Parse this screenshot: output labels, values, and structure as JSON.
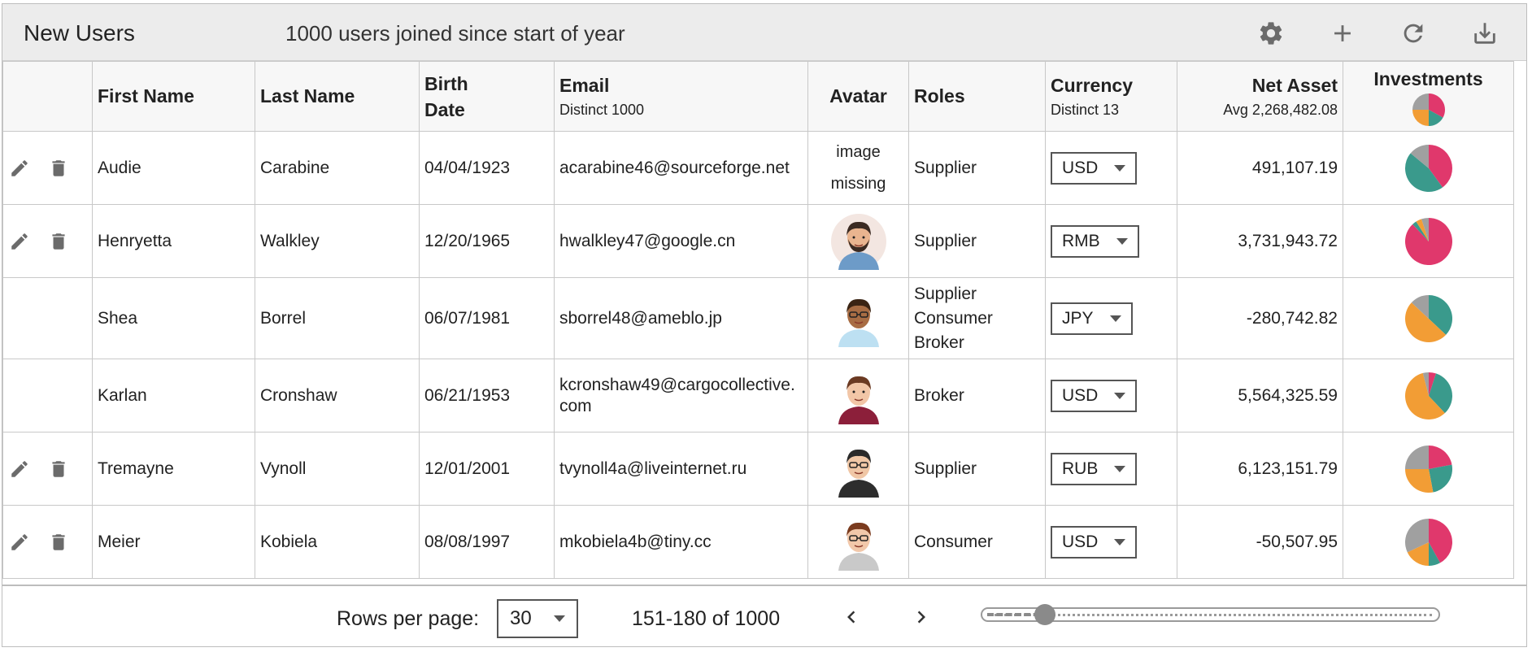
{
  "toolbar": {
    "title": "New Users",
    "subtitle": "1000 users joined since start of year",
    "icons": [
      "gear-icon",
      "plus-icon",
      "refresh-icon",
      "download-icon"
    ]
  },
  "columns": {
    "first_name": "First Name",
    "last_name": "Last Name",
    "birth_date_line1": "Birth",
    "birth_date_line2": "Date",
    "email": "Email",
    "email_sub": "Distinct 1000",
    "avatar": "Avatar",
    "roles": "Roles",
    "currency": "Currency",
    "currency_sub": "Distinct 13",
    "net_asset": "Net Asset",
    "net_asset_sub": "Avg 2,268,482.08",
    "investments": "Investments"
  },
  "header_pie": [
    0.33,
    0.17,
    0.25,
    0.25
  ],
  "colors": {
    "pie": [
      "#e0386c",
      "#3a9a8c",
      "#f29d35",
      "#a0a0a0"
    ],
    "icon": "#6b6b6b",
    "toolbar_bg": "#ececec"
  },
  "avatar_missing_text": [
    "image",
    "missing"
  ],
  "rows": [
    {
      "actions": true,
      "first": "Audie",
      "last": "Carabine",
      "birth": "04/04/1923",
      "email": [
        "acarabine46@sourceforge.net"
      ],
      "avatar": "missing",
      "roles": [
        "Supplier"
      ],
      "currency": "USD",
      "net": "491,107.19",
      "pie": [
        0.4,
        0.46,
        0.0,
        0.14
      ]
    },
    {
      "actions": true,
      "first": "Henryetta",
      "last": "Walkley",
      "birth": "12/20/1965",
      "email": [
        "hwalkley47@google.cn"
      ],
      "avatar": "man-beard",
      "roles": [
        "Supplier"
      ],
      "currency": "RMB",
      "net": "3,731,943.72",
      "pie": [
        0.88,
        0.03,
        0.04,
        0.05
      ]
    },
    {
      "actions": false,
      "first": "Shea",
      "last": "Borrel",
      "birth": "06/07/1981",
      "email": [
        "sborrel48@ameblo.jp"
      ],
      "avatar": "woman-glasses",
      "roles": [
        "Supplier",
        "Consumer",
        "Broker"
      ],
      "currency": "JPY",
      "net": "-280,742.82",
      "pie": [
        0.0,
        0.37,
        0.5,
        0.13
      ]
    },
    {
      "actions": false,
      "first": "Karlan",
      "last": "Cronshaw",
      "birth": "06/21/1953",
      "email": [
        "kcronshaw49@cargocollective.",
        "com"
      ],
      "avatar": "woman-red",
      "roles": [
        "Broker"
      ],
      "currency": "USD",
      "net": "5,564,325.59",
      "pie": [
        0.05,
        0.33,
        0.58,
        0.04
      ]
    },
    {
      "actions": true,
      "first": "Tremayne",
      "last": "Vynoll",
      "birth": "12/01/2001",
      "email": [
        "tvynoll4a@liveinternet.ru"
      ],
      "avatar": "man-glasses",
      "roles": [
        "Supplier"
      ],
      "currency": "RUB",
      "net": "6,123,151.79",
      "pie": [
        0.22,
        0.25,
        0.28,
        0.25
      ]
    },
    {
      "actions": true,
      "first": "Meier",
      "last": "Kobiela",
      "birth": "08/08/1997",
      "email": [
        "mkobiela4b@tiny.cc"
      ],
      "avatar": "woman-brown",
      "roles": [
        "Consumer"
      ],
      "currency": "USD",
      "net": "-50,507.95",
      "pie": [
        0.42,
        0.08,
        0.18,
        0.32
      ]
    }
  ],
  "footer": {
    "rows_per_page_label": "Rows per page:",
    "rows_per_page_value": "30",
    "range": "151-180 of 1000",
    "page_position": 0.12
  }
}
